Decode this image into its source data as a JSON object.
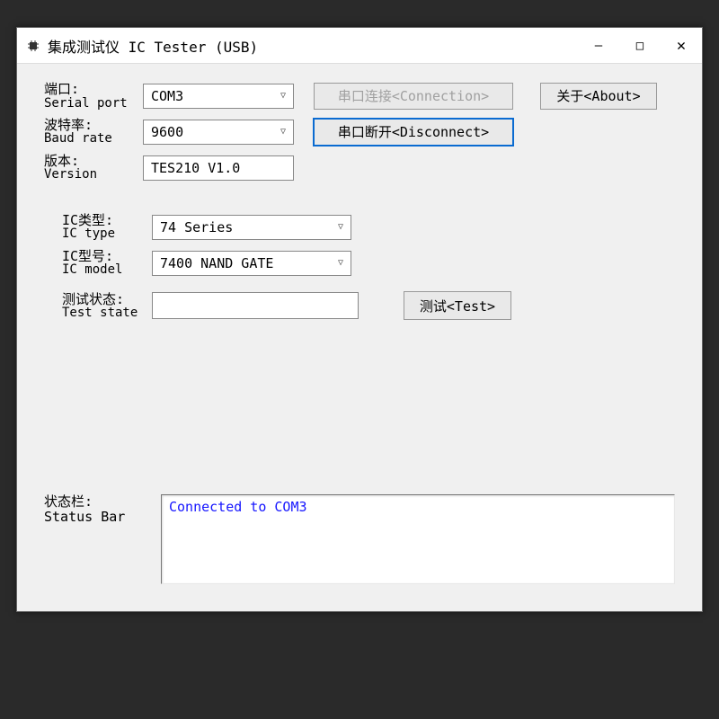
{
  "window": {
    "title": "集成测试仪 IC Tester (USB)",
    "controls": {
      "min": "—",
      "max": "□",
      "close": "✕"
    }
  },
  "labels": {
    "serial": {
      "cn": "端口:",
      "en": "Serial port"
    },
    "baud": {
      "cn": "波特率:",
      "en": "Baud rate"
    },
    "version": {
      "cn": "版本:",
      "en": "Version"
    },
    "ictype": {
      "cn": "IC类型:",
      "en": "IC type"
    },
    "icmodel": {
      "cn": "IC型号:",
      "en": "IC model"
    },
    "teststate": {
      "cn": "测试状态:",
      "en": "Test state"
    },
    "statusbar": {
      "cn": "状态栏:",
      "en": "Status Bar"
    }
  },
  "values": {
    "serial_port": "COM3",
    "baud_rate": "9600",
    "version": "TES210 V1.0",
    "ic_type": "74 Series",
    "ic_model": "7400 NAND GATE",
    "test_state": "",
    "status_text": "Connected to COM3"
  },
  "buttons": {
    "connect": "串口连接<Connection>",
    "disconnect": "串口断开<Disconnect>",
    "about": "关于<About>",
    "test": "测试<Test>"
  }
}
